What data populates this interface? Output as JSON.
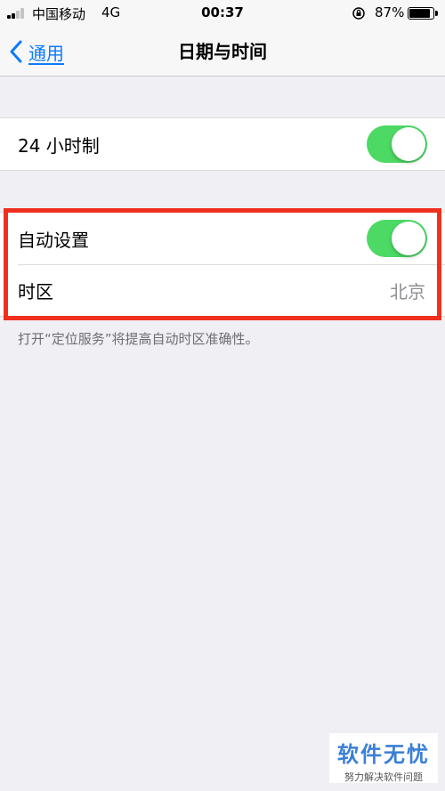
{
  "status_bar": {
    "carrier": "中国移动",
    "network": "4G",
    "time": "00:37",
    "battery_percent": "87%",
    "battery_level": 0.87
  },
  "nav": {
    "back_label": "通用",
    "title": "日期与时间"
  },
  "group_24h": {
    "label": "24 小时制",
    "toggle_on": true
  },
  "group_auto": {
    "auto_label": "自动设置",
    "auto_toggle_on": true,
    "timezone_label": "时区",
    "timezone_value": "北京"
  },
  "footnote": "打开“定位服务”将提高自动时区准确性。",
  "colors": {
    "accent": "#0a7aff",
    "toggle_on": "#4cd964",
    "highlight": "#f0301e",
    "background": "#efeff4"
  },
  "watermark": {
    "title": "软件无忧",
    "subtitle": "努力解决软件问题"
  }
}
